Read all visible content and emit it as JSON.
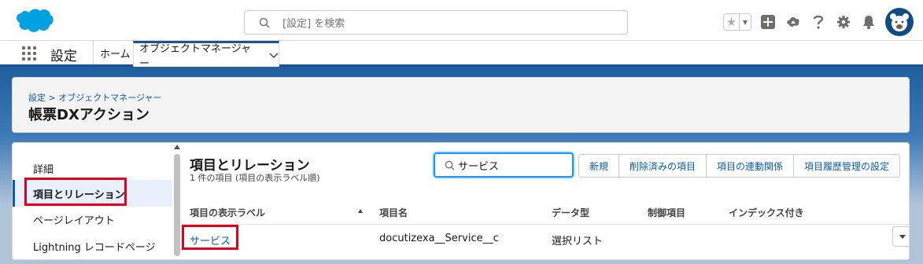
{
  "global_header": {
    "search_placeholder": "[設定] を検索",
    "icons": [
      "salesforce-cloud-logo",
      "favorite-star-icon",
      "favorite-list-dropdown-icon",
      "add-icon",
      "trailhead-icon",
      "help-icon",
      "setup-gear-icon",
      "notification-bell-icon",
      "user-avatar"
    ]
  },
  "nav": {
    "app_name": "設定",
    "home_tab": "ホーム",
    "active_tab": "オブジェクトマネージャー"
  },
  "page_header": {
    "breadcrumb": "設定 > オブジェクトマネージャー",
    "title": "帳票DXアクション"
  },
  "sidebar": {
    "items": [
      {
        "label": "詳細"
      },
      {
        "label": "項目とリレーション"
      },
      {
        "label": "ページレイアウト"
      },
      {
        "label": "Lightning レコードページ"
      }
    ]
  },
  "section": {
    "title": "項目とリレーション",
    "subtitle": "1 件の項目 (項目の表示ラベル順)",
    "filter_value": "サービス",
    "buttons": [
      "新規",
      "削除済みの項目",
      "項目の連動関係",
      "項目履歴管理の設定"
    ]
  },
  "table": {
    "headers": [
      "項目の表示ラベル",
      "項目名",
      "データ型",
      "制御項目",
      "インデックス付き"
    ],
    "rows": [
      {
        "label": "サービス",
        "api_name": "docutizexa__Service__c",
        "type": "選択リスト",
        "controlling": "",
        "indexed": ""
      }
    ]
  },
  "colors": {
    "brand_blue": "#1b5297",
    "link": "#0b5cab",
    "highlight": "#e3001b"
  }
}
